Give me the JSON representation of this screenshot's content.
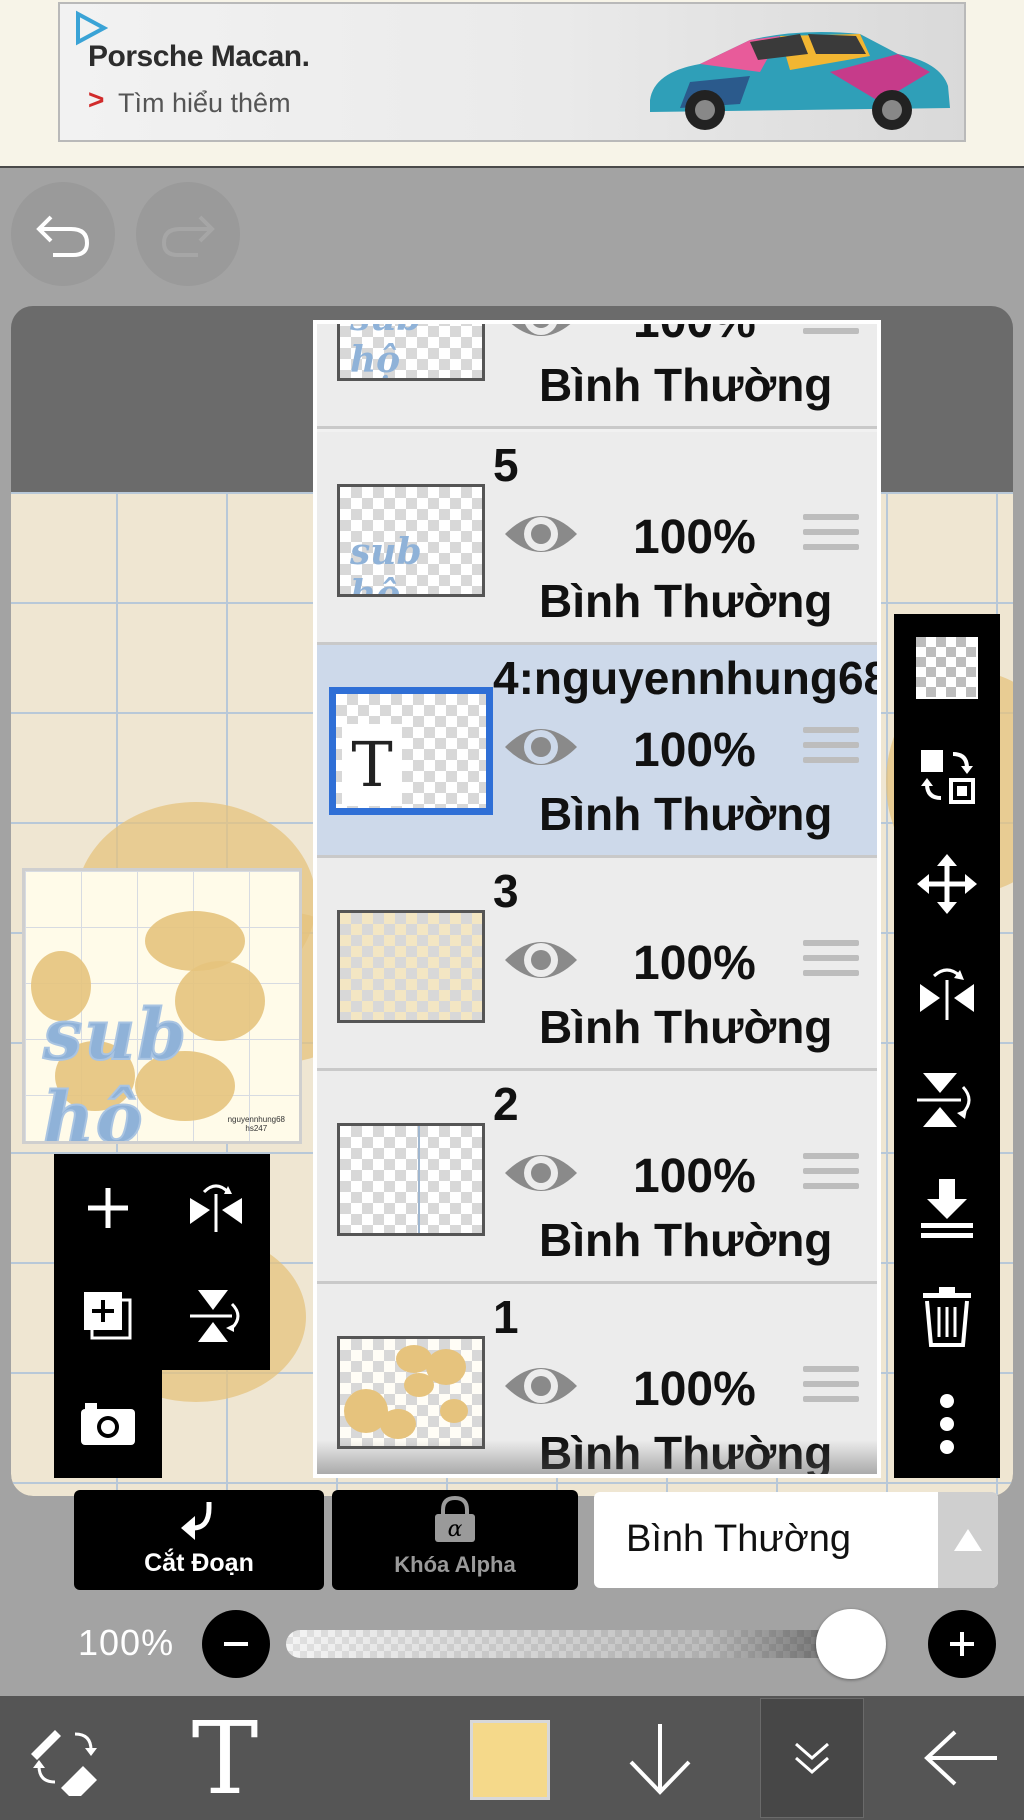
{
  "ad": {
    "title": "Porsche Macan.",
    "link_arrow": ">",
    "link_text": "Tìm hiểu thêm"
  },
  "thumbnail": {
    "title_art": "sub hộ",
    "signature_line1": "nguyennhung68",
    "signature_line2": "hs247"
  },
  "layers": [
    {
      "name": "",
      "opacity": "100%",
      "blend": "Bình Thường",
      "thumb_text": "sub hộ",
      "selected": false
    },
    {
      "name": "5",
      "opacity": "100%",
      "blend": "Bình Thường",
      "thumb_text": "sub hộ",
      "selected": false
    },
    {
      "name": "4:nguyennhung68",
      "opacity": "100%",
      "blend": "Bình Thường",
      "thumb_text": "T",
      "selected": true
    },
    {
      "name": "3",
      "opacity": "100%",
      "blend": "Bình Thường",
      "selected": false
    },
    {
      "name": "2",
      "opacity": "100%",
      "blend": "Bình Thường",
      "selected": false
    },
    {
      "name": "1",
      "opacity": "100%",
      "blend": "Bình Thường",
      "selected": false
    }
  ],
  "controls": {
    "clip_label": "Cắt Đoạn",
    "alpha_lock_label": "Khóa Alpha",
    "blend_mode_value": "Bình Thường",
    "opacity_label": "100%",
    "opacity_value": 1.0
  },
  "bottom_nav": {
    "text_tool_glyph": "T",
    "current_color": "#f5d98a"
  },
  "icons": {
    "ad": [
      "ad-play-icon",
      "car-image"
    ],
    "top": [
      "undo-icon",
      "redo-icon"
    ],
    "left_tools": [
      "add-layer-icon",
      "flip-horizontal-icon",
      "duplicate-layer-icon",
      "flip-vertical-icon",
      "camera-icon"
    ],
    "right_toolbar": [
      "transparency-icon",
      "swap-select-icon",
      "move-icon",
      "flip-horizontal-icon",
      "flip-vertical-icon",
      "merge-down-icon",
      "trash-icon",
      "more-icon"
    ],
    "bottom_nav": [
      "eraser-swap-icon",
      "text-tool-icon",
      "color-swatch",
      "down-arrow-icon",
      "collapse-icon",
      "back-arrow-icon"
    ]
  },
  "colors": {
    "selected_layer_border": "#2f6fd6",
    "selected_layer_bg": "#cdd9ea",
    "ad_arrow": "#d12b2b"
  }
}
